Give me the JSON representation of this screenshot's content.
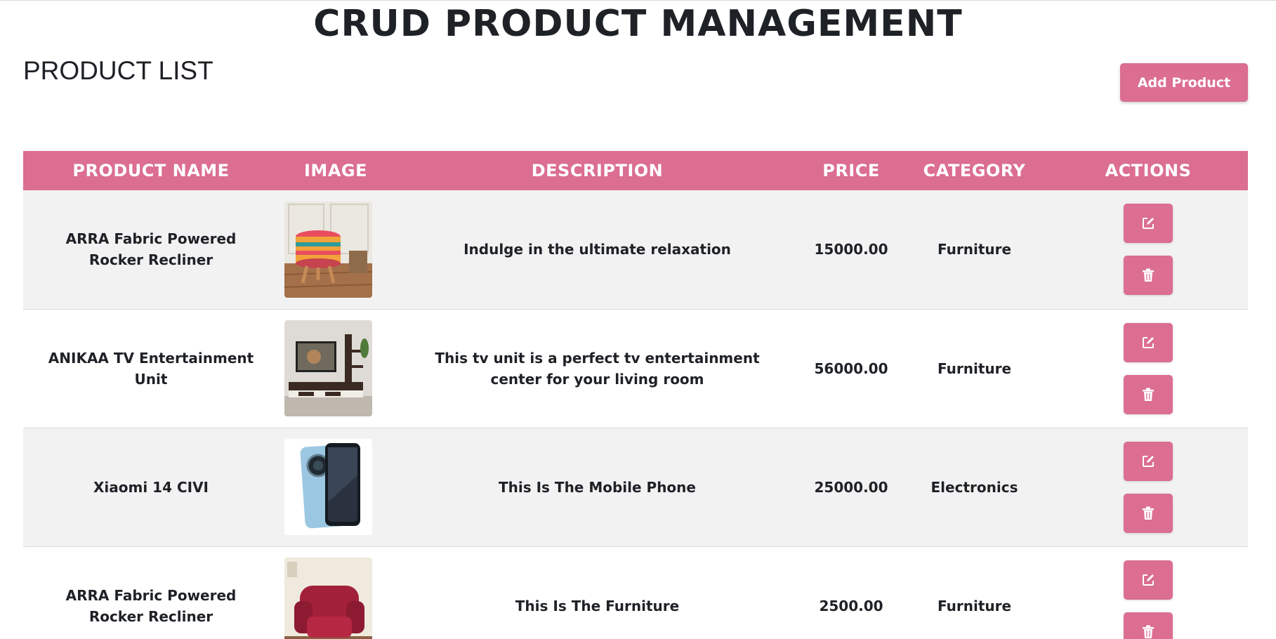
{
  "app": {
    "title": "CRUD PRODUCT MANAGEMENT"
  },
  "page": {
    "list_title": "PRODUCT LIST",
    "add_button_label": "Add Product"
  },
  "table": {
    "headers": [
      "PRODUCT NAME",
      "IMAGE",
      "DESCRIPTION",
      "PRICE",
      "CATEGORY",
      "ACTIONS"
    ],
    "rows": [
      {
        "name": "ARRA Fabric Powered Rocker Recliner",
        "image": "patterned-fabric-stool",
        "description": "Indulge in the ultimate relaxation",
        "price": "15000.00",
        "category": "Furniture"
      },
      {
        "name": "ANIKAA TV Entertainment Unit",
        "image": "tv-entertainment-unit",
        "description": "This tv unit is a perfect tv entertainment center for your living room",
        "price": "56000.00",
        "category": "Furniture"
      },
      {
        "name": "Xiaomi 14 CIVI",
        "image": "blue-smartphone",
        "description": "This Is The Mobile Phone",
        "price": "25000.00",
        "category": "Electronics"
      },
      {
        "name": "ARRA Fabric Powered Rocker Recliner",
        "image": "red-recliner-chair",
        "description": "This Is The Furniture",
        "price": "2500.00",
        "category": "Furniture"
      }
    ]
  },
  "icons": {
    "edit": "edit-icon",
    "delete": "trash-icon"
  },
  "colors": {
    "accent": "#db6e91",
    "row_shade": "#f2f2f2",
    "text": "#1e2126"
  }
}
